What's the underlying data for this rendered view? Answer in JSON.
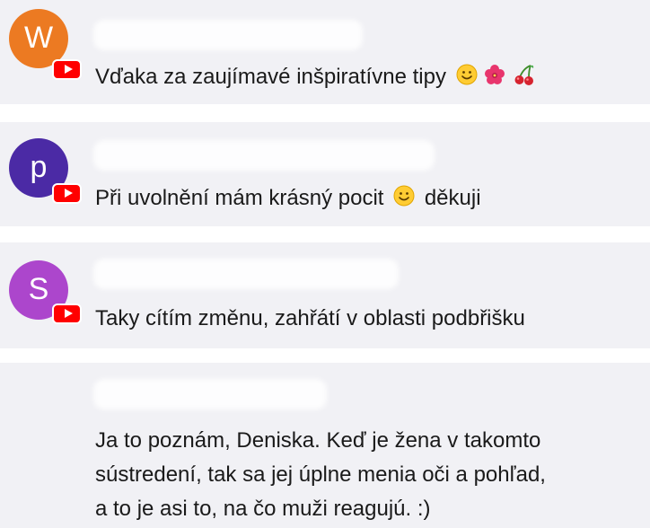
{
  "comments": [
    {
      "avatar_letter": "W",
      "avatar_color": "#ec7a22",
      "text": "Vďaka za zaujímavé inšpiratívne tipy",
      "trailing_emojis": [
        "smiley-icon",
        "flower-icon",
        "cherries-icon"
      ]
    },
    {
      "avatar_letter": "p",
      "avatar_color": "#4b2aa5",
      "text_before": "Při uvolnění mám krásný pocit",
      "text_after": "děkuji",
      "inline_emoji": "smiley-icon"
    },
    {
      "avatar_letter": "S",
      "avatar_color": "#ac46cc",
      "text": "Taky cítím změnu, zahřátí v oblasti podbřišku"
    },
    {
      "text": "Ja to poznám, Deniska. Keď je žena v takomto\nsústredení, tak sa jej úplne menia oči a pohľad,\na to je asi to, na čo muži reagujú. :)"
    }
  ],
  "colors": {
    "youtube_red": "#ff0000",
    "card_background": "#f1f1f5",
    "text": "#1a1a1a"
  }
}
